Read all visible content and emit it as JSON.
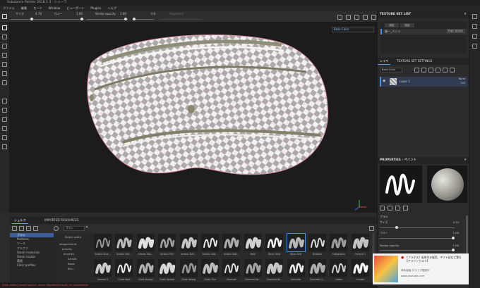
{
  "window": {
    "title": "Substance Painter 2018.1.3 - シューワ"
  },
  "menu": [
    "ファイル",
    "編集",
    "モード",
    "Window",
    "ビューポート",
    "Plugins",
    "ヘルプ"
  ],
  "tool_options": {
    "size_label": "サイズ",
    "size_value": "4.74",
    "flow_label": "フロー",
    "flow_value": "1.00",
    "stroke_label": "Stroke opacity",
    "stroke_value": "1.00",
    "extra_value": "0.0",
    "alignment_label": "Alignment"
  },
  "viewport": {
    "channel_select": "Base Color"
  },
  "texture_set_list": {
    "title": "TEXTURE SET LIST",
    "btn_a": "設定",
    "btn_b": "設定",
    "item_name": "服ー_パンツ",
    "item_shader": "Main shader"
  },
  "layers": {
    "tab_layers": "レイヤ",
    "tab_settings": "TEXTURE SET SETTINGS",
    "channel_select": "Base Color",
    "layer_name": "Layer 1",
    "blend_mode": "Norm",
    "opacity": "100"
  },
  "properties": {
    "title": "PROPERTIES - ペイント",
    "brush_heading": "ブラシ",
    "size_label": "サイズ",
    "size_value": "4.74",
    "flow_label": "フロー",
    "flow_value": "1.00",
    "stroke_label": "Stroke opacity",
    "stroke_value": "1.00"
  },
  "shelf": {
    "tab_shelf": "シェルフ",
    "tab_imported": "IMPORTED RESOURCES",
    "search_placeholder": "ブラシ",
    "categories": [
      "ブラシ",
      "Particles",
      "ツール",
      "アルファ",
      "Smart materials",
      "Smart masks",
      "環境",
      "Color profiles"
    ],
    "selected_category": 0,
    "tree": {
      "root": "Select paths",
      "lib": "allegorithmic",
      "presets": "presets",
      "brushes": "brushes",
      "sub": [
        "Artistic",
        "Basic",
        "Bru…"
      ]
    },
    "brushes_row1": [
      "Artistic Brus…",
      "Artistic Hair…",
      "Artistic Hea…",
      "Artistic Print",
      "Artistic Soft…",
      "Artistic Soft…",
      "Artistic Soft…",
      "Bark",
      "Basic Hard",
      "Basic Soft",
      "Bubbles",
      "Calligraphic",
      "Cement 1"
    ],
    "brushes_row2": [
      "Cement 2",
      "Chalk Bold",
      "Chalk Bumpy",
      "Chalk Spread",
      "Chalk Strong",
      "Chalk Thin",
      "Charcoal",
      "Charcoal Me…",
      "Charcoal Wi…",
      "Concrete",
      "Concrete Li…",
      "Cotton",
      "Crackle"
    ],
    "selected_brush": "Basic Soft"
  },
  "statusbar": {
    "message": "[Path editor] Invalid source. mesh: Mapfiled/Ono.b4_UV coordinates"
  },
  "ad": {
    "title": "【ブラグス】出所付き販売、ギフト初など実行【アラソンテスト】",
    "channel": "有料漫画 ダライブ配信中",
    "url": "www.youtube.com"
  },
  "colors": {
    "accent": "#4a90e2",
    "background": "#2b2b2b",
    "selection": "#3b5f9a"
  }
}
